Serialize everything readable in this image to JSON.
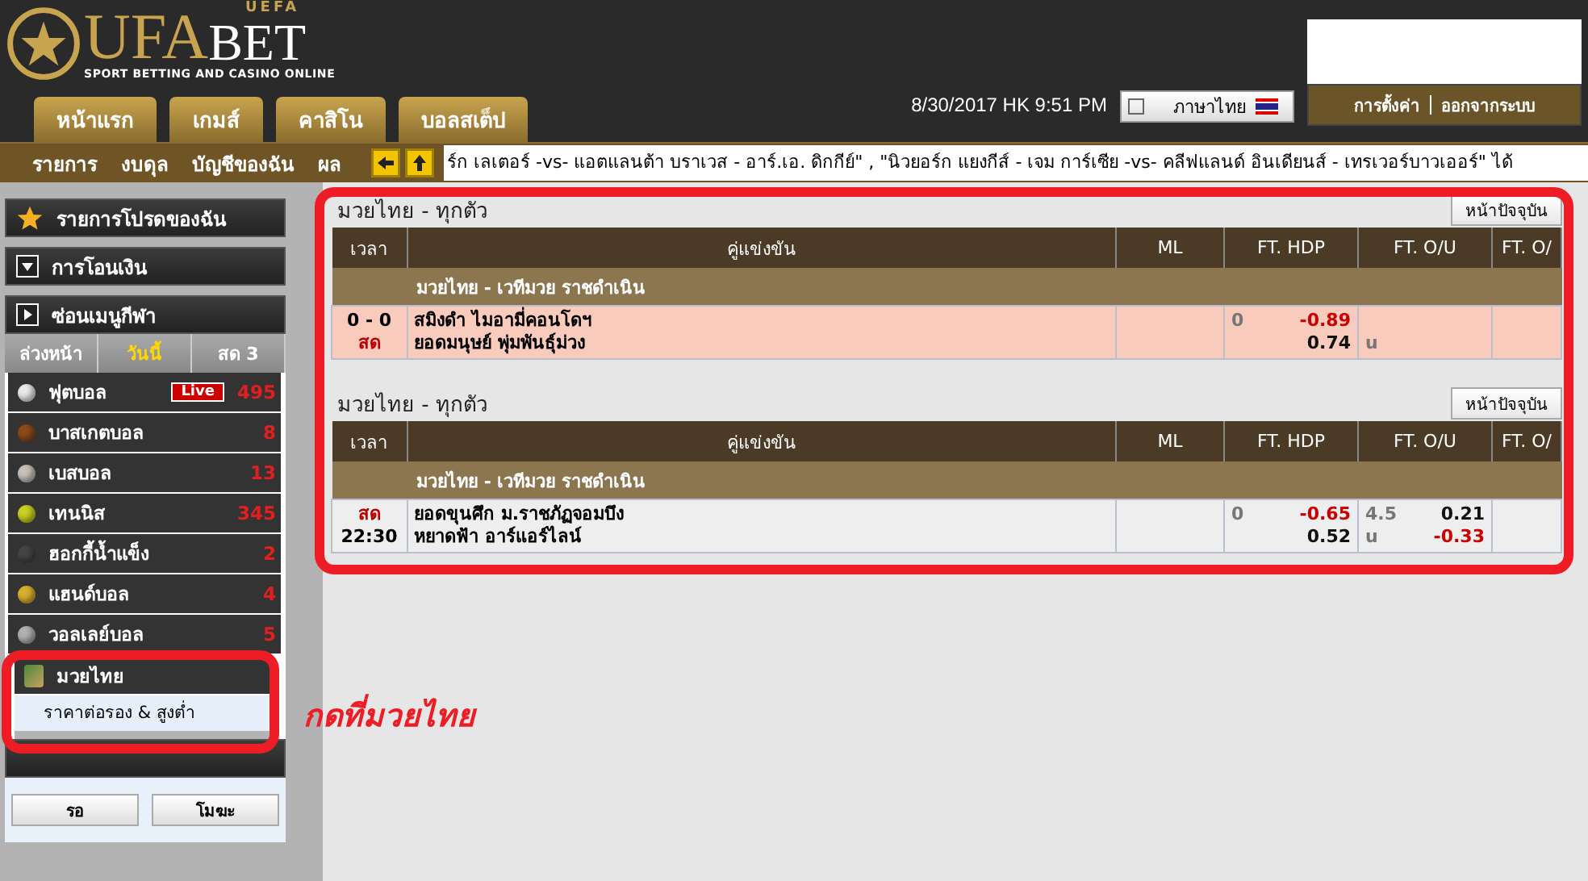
{
  "header": {
    "logo_main": "UFA",
    "logo_bet": "BET",
    "logo_top": "UEFA",
    "logo_sub": "SPORT BETTING AND CASINO ONLINE",
    "tabs": [
      {
        "label": "หน้าแรก",
        "selected": false
      },
      {
        "label": "เกมส์",
        "selected": false
      },
      {
        "label": "คาสิโน",
        "selected": false
      },
      {
        "label": "บอลสเต็ป",
        "selected": false
      }
    ],
    "datetime": "8/30/2017 HK 9:51 PM",
    "language": "ภาษาไทย",
    "account_links": [
      "การตั้งค่า",
      "ออกจากระบบ"
    ]
  },
  "subnav": {
    "items": [
      "รายการ",
      "งบดุล",
      "บัญชีของฉัน",
      "ผล"
    ],
    "ticker": "ร์ก เลเตอร์ -vs- แอตแลนต้า บราเวส - อาร์.เอ. ดิกกีย์\" , \"นิวยอร์ก แยงกีส์ - เจม การ์เซีย -vs- คลีฟแลนด์ อินเดียนส์ - เทรเวอร์บาวเออร์\" ได้"
  },
  "sidebar": {
    "favorites": "รายการโปรดของฉัน",
    "transfer": "การโอนเงิน",
    "sports_menu": "ซ่อนเมนูกีฬา",
    "period_tabs": [
      {
        "label": "ล่วงหน้า",
        "selected": false
      },
      {
        "label": "วันนี้",
        "selected": true
      },
      {
        "label": "สด 3",
        "selected": false
      }
    ],
    "sports": [
      {
        "name": "ฟุตบอล",
        "count": "495",
        "live": true,
        "live_label": "Live",
        "color": "#e8e8e8"
      },
      {
        "name": "บาสเกตบอล",
        "count": "8",
        "live": false,
        "color": "#8a4a1a"
      },
      {
        "name": "เบสบอล",
        "count": "13",
        "live": false,
        "color": "#c8c0b8"
      },
      {
        "name": "เทนนิส",
        "count": "345",
        "live": false,
        "color": "#c8d020"
      },
      {
        "name": "ฮอกกี้น้ำแข็ง",
        "count": "2",
        "live": false,
        "color": "#444444"
      },
      {
        "name": "แฮนด์บอล",
        "count": "4",
        "live": false,
        "color": "#d8b030"
      },
      {
        "name": "วอลเลย์บอล",
        "count": "5",
        "live": false,
        "color": "#b0b0b0"
      }
    ],
    "expanded_sport": {
      "name": "มวยไทย",
      "expanded": true,
      "sub_items": [
        "ราคาต่อรอง & สูงต่ำ"
      ]
    },
    "buttons": [
      "รอ",
      "โมฆะ"
    ]
  },
  "annotation": "กดที่มวยไทย",
  "sections": [
    {
      "title": "มวยไทย - ทุกตัว",
      "refresh": "หน้าปัจจุบัน",
      "columns": [
        "เวลา",
        "คู่แข่งขัน",
        "ML",
        "FT. HDP",
        "FT. O/U",
        "FT. O/"
      ],
      "league": "มวยไทย - เวทีมวย ราชดำเนิน",
      "matches": [
        {
          "highlighted": true,
          "time": [
            {
              "text": "0 - 0",
              "live": false
            },
            {
              "text": "สด",
              "live": true
            }
          ],
          "teams": [
            "สมิงดำ ไมอามี่คอนโดฯ",
            "ยอดมนุษย์ พุ่มพันธุ์ม่วง"
          ],
          "hdp_line": "0",
          "hdp_odds": [
            {
              "text": "-0.89",
              "negative": true
            },
            {
              "text": "0.74",
              "negative": false
            }
          ],
          "ou_side": "u"
        }
      ]
    },
    {
      "title": "มวยไทย - ทุกตัว",
      "refresh": "หน้าปัจจุบัน",
      "columns": [
        "เวลา",
        "คู่แข่งขัน",
        "ML",
        "FT. HDP",
        "FT. O/U",
        "FT. O/"
      ],
      "league": "มวยไทย - เวทีมวย ราชดำเนิน",
      "matches": [
        {
          "highlighted": false,
          "time": [
            {
              "text": "สด",
              "live": true
            },
            {
              "text": "22:30",
              "live": false
            }
          ],
          "teams": [
            "ยอดขุนศึก ม.ราชภัฏจอมบึง",
            "หยาดฟ้า อาร์แอร์ไลน์"
          ],
          "hdp_line": "0",
          "hdp_odds": [
            {
              "text": "-0.65",
              "negative": true
            },
            {
              "text": "0.52",
              "negative": false
            }
          ],
          "ou_line": "4.5",
          "ou_side": "u",
          "ou_odds": [
            {
              "text": "0.21",
              "negative": false
            },
            {
              "text": "-0.33",
              "negative": true
            }
          ]
        }
      ]
    }
  ]
}
